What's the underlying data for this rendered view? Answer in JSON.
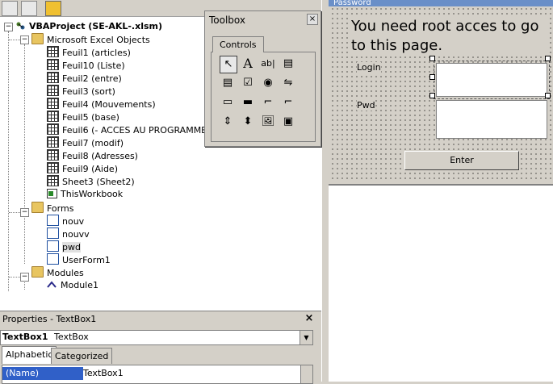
{
  "project_tree": {
    "root": "VBAProject (SE-AKL-.xlsm)",
    "excel_objects_folder": "Microsoft Excel Objects",
    "sheets": [
      "Feuil1 (articles)",
      "Feuil10 (Liste)",
      "Feuil2 (entre)",
      "Feuil3 (sort)",
      "Feuil4 (Mouvements)",
      "Feuil5 (base)",
      "Feuil6 (-      ACCES AU PROGRAMME",
      "Feuil7 (modif)",
      "Feuil8 (Adresses)",
      "Feuil9 (Aide)",
      "Sheet3 (Sheet2)"
    ],
    "workbook": "ThisWorkbook",
    "forms_folder": "Forms",
    "forms": [
      "nouv",
      "nouvv",
      "pwd",
      "UserForm1"
    ],
    "modules_folder": "Modules",
    "modules": [
      "Module1"
    ]
  },
  "properties": {
    "title": "Properties - TextBox1",
    "close": "×",
    "object_name": "TextBox1",
    "object_type": "TextBox",
    "tabs": [
      "Alphabetic",
      "Categorized"
    ],
    "row_name": "(Name)",
    "row_value": "TextBox1"
  },
  "toolbox": {
    "title": "Toolbox",
    "close": "×",
    "tab": "Controls",
    "tools": [
      "select-objects",
      "label",
      "textbox",
      "combobox",
      "listbox",
      "checkbox",
      "optionbutton",
      "togglebutton",
      "frame",
      "commandbutton",
      "tabstrip",
      "multipage",
      "scrollbar",
      "spinbutton",
      "image",
      "refedit"
    ]
  },
  "form": {
    "title": "Password",
    "message": "You need root acces to go to this page.",
    "login_label": "Login",
    "pwd_label": "Pwd",
    "enter_button": "Enter"
  },
  "colors": {
    "selection": "#3060c8",
    "form_background": "#d4d0c8",
    "folder": "#e8c560"
  }
}
